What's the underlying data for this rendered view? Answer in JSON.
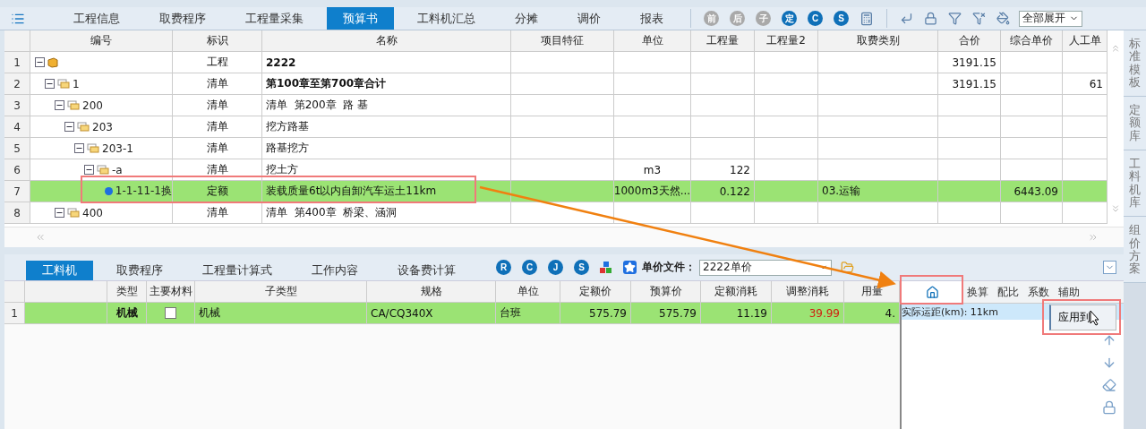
{
  "top_tabs": [
    {
      "label": "工程信息",
      "selected": false
    },
    {
      "label": "取费程序",
      "selected": false
    },
    {
      "label": "工程量采集",
      "selected": false
    },
    {
      "label": "预算书",
      "selected": true
    },
    {
      "label": "工料机汇总",
      "selected": false
    },
    {
      "label": "分摊",
      "selected": false
    },
    {
      "label": "调价",
      "selected": false
    },
    {
      "label": "报表",
      "selected": false
    }
  ],
  "toolbar": {
    "buttons": [
      {
        "glyph": "前",
        "disabled": true
      },
      {
        "glyph": "后",
        "disabled": true
      },
      {
        "glyph": "子",
        "disabled": true
      },
      {
        "glyph": "定",
        "disabled": false
      },
      {
        "glyph": "C",
        "disabled": false
      },
      {
        "glyph": "S",
        "disabled": false
      }
    ],
    "expand_select": "全部展开"
  },
  "grid": {
    "columns": [
      "编号",
      "标识",
      "名称",
      "项目特征",
      "单位",
      "工程量",
      "工程量2",
      "取费类别",
      "合价",
      "综合单价",
      "人工单"
    ],
    "rows": [
      {
        "no": "1",
        "kind": "project",
        "expanded": true,
        "selected": false,
        "bold": true,
        "mark": "工程",
        "name": "2222",
        "total": "3191.15",
        "children": [
          {
            "no": "2",
            "code": "1",
            "kind": "bill",
            "expanded": true,
            "selected": false,
            "bold": true,
            "mark": "清单",
            "name": "第100章至第700章合计",
            "total": "3191.15",
            "labor": "61",
            "children": [
              {
                "no": "3",
                "code": "200",
                "kind": "bill",
                "expanded": true,
                "selected": false,
                "bold": false,
                "mark": "清单",
                "name": "清单  第200章  路 基",
                "children": [
                  {
                    "no": "4",
                    "code": "203",
                    "kind": "bill",
                    "expanded": true,
                    "selected": false,
                    "bold": false,
                    "mark": "清单",
                    "name": "挖方路基",
                    "children": [
                      {
                        "no": "5",
                        "code": "203-1",
                        "kind": "bill",
                        "expanded": true,
                        "selected": false,
                        "bold": false,
                        "mark": "清单",
                        "name": "路基挖方",
                        "children": [
                          {
                            "no": "6",
                            "code": "-a",
                            "kind": "bill",
                            "expanded": true,
                            "selected": false,
                            "bold": false,
                            "mark": "清单",
                            "name": "挖土方",
                            "unit": "m3",
                            "qty": "122",
                            "children": [
                              {
                                "no": "7",
                                "code": "1-1-11-1换",
                                "kind": "quota",
                                "selected": true,
                                "bold": false,
                                "mark": "定额",
                                "name": "装载质量6t以内自卸汽车运土11km",
                                "unit": "1000m3天然...",
                                "qty": "0.122",
                                "fee_type": "03.运输",
                                "unit_price": "6443.09"
                              }
                            ]
                          }
                        ]
                      }
                    ]
                  }
                ]
              },
              {
                "no": "8",
                "code": "400",
                "kind": "bill",
                "expanded": true,
                "selected": false,
                "bold": false,
                "mark": "清单",
                "name": "清单  第400章  桥梁、涵洞"
              }
            ]
          }
        ]
      }
    ]
  },
  "lower_tabs": [
    {
      "label": "工料机",
      "selected": true
    },
    {
      "label": "取费程序",
      "selected": false
    },
    {
      "label": "工程量计算式",
      "selected": false
    },
    {
      "label": "工作内容",
      "selected": false
    },
    {
      "label": "设备费计算",
      "selected": false
    }
  ],
  "lower_toolbar": {
    "glyphs": [
      "R",
      "C",
      "J",
      "S"
    ],
    "price_file_label": "单价文件：",
    "price_file": "2222单价"
  },
  "resources": {
    "columns": [
      "类型",
      "主要材料",
      "子类型",
      "规格",
      "单位",
      "定额价",
      "预算价",
      "定额消耗",
      "调整消耗",
      "用量"
    ],
    "rows": [
      {
        "no": "1",
        "selected": true,
        "type": "机械",
        "main_material": false,
        "subtype": "机械",
        "spec": "CA/CQ340X",
        "unit": "台班",
        "quota_price": "575.79",
        "budget_price": "575.79",
        "quota_consumption": "11.19",
        "adjusted_consumption": "39.99",
        "adjusted_changed": true,
        "amount": "4."
      }
    ]
  },
  "adjust_pane": {
    "tabs": [
      {
        "kind": "home",
        "selected": true
      },
      {
        "kind": "text",
        "label": "换算",
        "selected": false
      },
      {
        "kind": "text",
        "label": "配比",
        "selected": false
      },
      {
        "kind": "text",
        "label": "系数",
        "selected": false
      },
      {
        "kind": "text",
        "label": "辅助",
        "selected": false
      }
    ],
    "entries": [
      {
        "text": "实际运距(km): 11km",
        "selected": true
      }
    ],
    "popup": [
      "应用到"
    ]
  },
  "side_tabs": [
    "标准模板",
    "定额库",
    "工料机库",
    "组价方案"
  ]
}
